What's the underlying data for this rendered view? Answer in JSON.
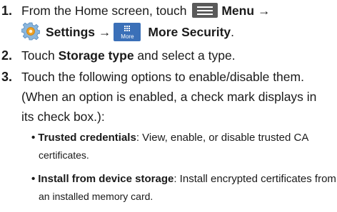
{
  "steps": [
    {
      "number": "1.",
      "line1": {
        "prefix": "From the Home screen, touch ",
        "menu_label": "Menu",
        "arrow": "→"
      },
      "line2": {
        "settings_label": "Settings",
        "arrow": "→",
        "more_icon_text": "More",
        "more_security_label": "More Security",
        "suffix": "."
      }
    },
    {
      "number": "2.",
      "prefix": "Touch ",
      "bold": "Storage type",
      "suffix": " and select a type."
    },
    {
      "number": "3.",
      "lines": [
        "Touch the following options to enable/disable them.",
        "(When an option is enabled, a check mark displays in",
        "its check box.):"
      ]
    }
  ],
  "bullets": [
    {
      "marker": "•",
      "term": "Trusted credentials",
      "text": ": View, enable, or disable trusted CA",
      "cont": "certificates."
    },
    {
      "marker": "•",
      "term": "Install from device storage",
      "text": ": Install encrypted certificates from",
      "cont": "an installed memory card."
    }
  ],
  "icons": {
    "menu": "menu-icon",
    "settings": "gear-icon",
    "more": "more-icon"
  },
  "colors": {
    "text": "#1a1a1a",
    "menu_icon": "#5a5a5a",
    "more_icon": "#3b70b8",
    "gear_outer": "#8ab6dc",
    "gear_inner": "#f0a020"
  }
}
